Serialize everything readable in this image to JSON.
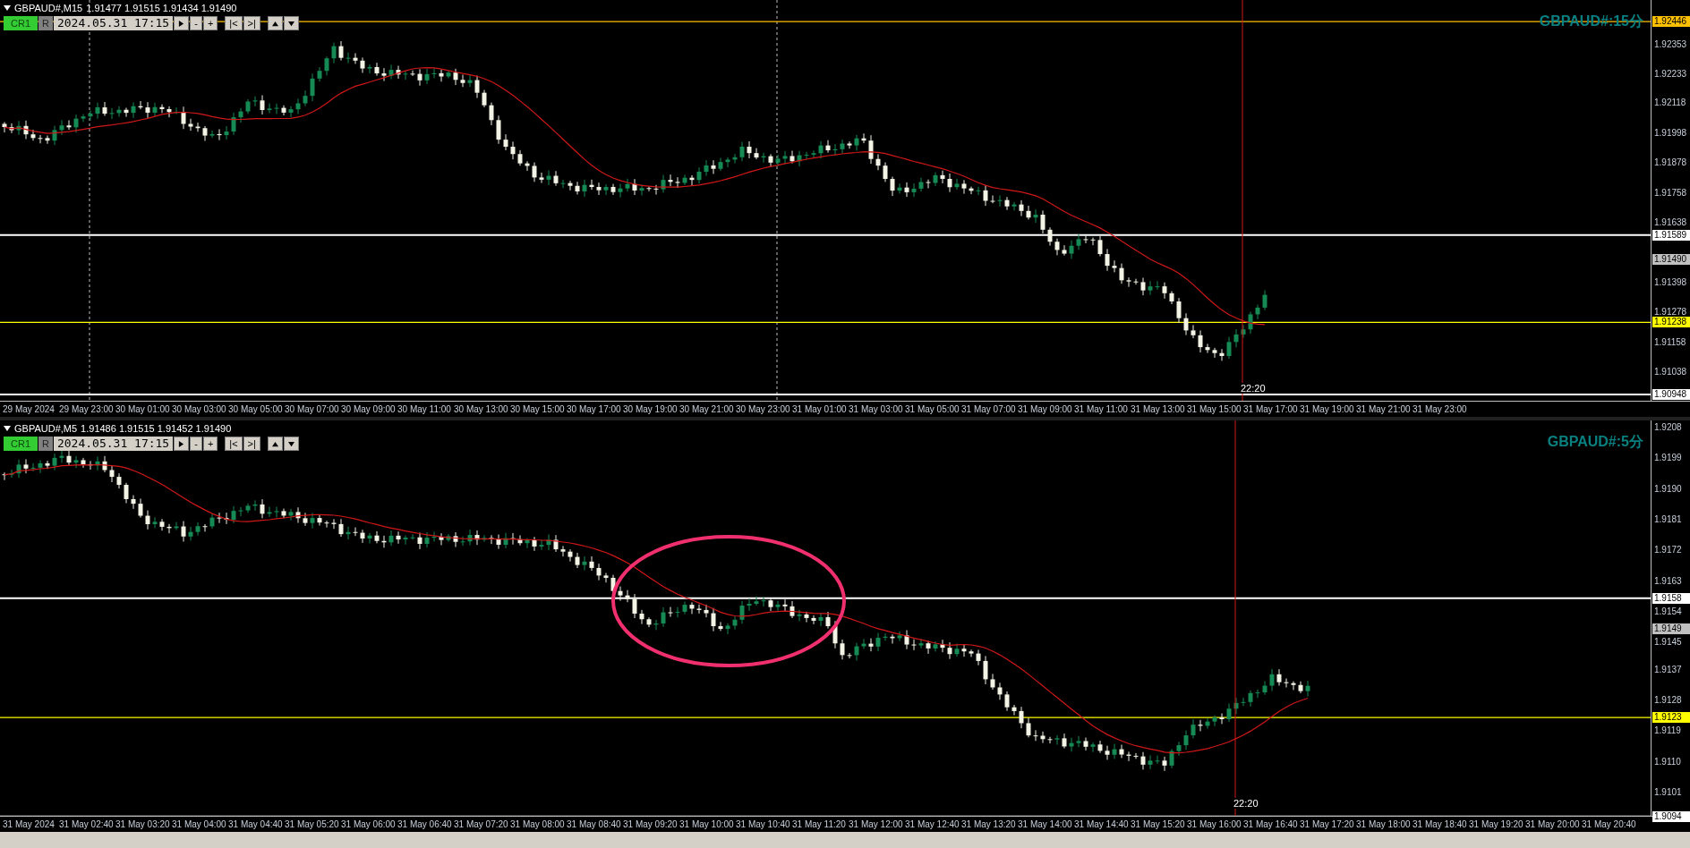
{
  "panels": [
    {
      "kind": "m15",
      "symbol": "GBPAUD#,M15",
      "ohlc": "1.91477 1.91515 1.91434 1.91490",
      "toolbar": {
        "cr": "CR1",
        "r": "R",
        "date": "2024.05.31 17:15",
        "zoom_buttons": [
          "-",
          "+"
        ],
        "jump_buttons": [
          "|<",
          ">|"
        ]
      },
      "chart_title": "GBPAUD#:15分",
      "price_ticks": [
        "1.92353",
        "1.92233",
        "1.92118",
        "1.91998",
        "1.91878",
        "1.91758",
        "1.91638",
        "1.91398",
        "1.91278",
        "1.91158",
        "1.91038"
      ],
      "levels": [
        {
          "label": "1.92446",
          "color": "#ffc000"
        },
        {
          "label": "1.91589",
          "color": "#ffffff"
        },
        {
          "label": "1.91238",
          "color": "#ffff00"
        },
        {
          "label": "1.90948",
          "color": "#ffffff"
        }
      ],
      "bid_tag": "1.91490",
      "cursor_time": "22:20",
      "time_labels": [
        "29 May 2024",
        "29 May 23:00",
        "30 May 01:00",
        "30 May 03:00",
        "30 May 05:00",
        "30 May 07:00",
        "30 May 09:00",
        "30 May 11:00",
        "30 May 13:00",
        "30 May 15:00",
        "30 May 17:00",
        "30 May 19:00",
        "30 May 21:00",
        "30 May 23:00",
        "31 May 01:00",
        "31 May 03:00",
        "31 May 05:00",
        "31 May 07:00",
        "31 May 09:00",
        "31 May 11:00",
        "31 May 13:00",
        "31 May 15:00",
        "31 May 17:00",
        "31 May 19:00",
        "31 May 21:00",
        "31 May 23:00"
      ]
    },
    {
      "kind": "m5",
      "symbol": "GBPAUD#,M5",
      "ohlc": "1.91486 1.91515 1.91452 1.91490",
      "toolbar": {
        "cr": "CR1",
        "r": "R",
        "date": "2024.05.31 17:15",
        "zoom_buttons": [
          "-",
          "+"
        ],
        "jump_buttons": [
          "|<",
          ">|"
        ]
      },
      "chart_title": "GBPAUD#:5分",
      "price_ticks": [
        "1.9208",
        "1.9199",
        "1.9190",
        "1.9181",
        "1.9172",
        "1.9163",
        "1.9154",
        "1.9145",
        "1.9137",
        "1.9128",
        "1.9119",
        "1.9110",
        "1.9101"
      ],
      "levels": [
        {
          "label": "1.9158",
          "color": "#ffffff"
        },
        {
          "label": "1.9123",
          "color": "#ffff00"
        },
        {
          "label": "1.9094",
          "color": "#ffffff"
        }
      ],
      "bid_tag": "1.9149",
      "cursor_time": "22:20",
      "highlight_ellipse": true,
      "time_labels": [
        "31 May 2024",
        "31 May 02:40",
        "31 May 03:20",
        "31 May 04:00",
        "31 May 04:40",
        "31 May 05:20",
        "31 May 06:00",
        "31 May 06:40",
        "31 May 07:20",
        "31 May 08:00",
        "31 May 08:40",
        "31 May 09:20",
        "31 May 10:00",
        "31 May 10:40",
        "31 May 11:20",
        "31 May 12:00",
        "31 May 12:40",
        "31 May 13:20",
        "31 May 14:00",
        "31 May 14:40",
        "31 May 15:20",
        "31 May 16:00",
        "31 May 16:40",
        "31 May 17:20",
        "31 May 18:00",
        "31 May 18:40",
        "31 May 19:20",
        "31 May 20:00",
        "31 May 20:40"
      ]
    }
  ]
}
